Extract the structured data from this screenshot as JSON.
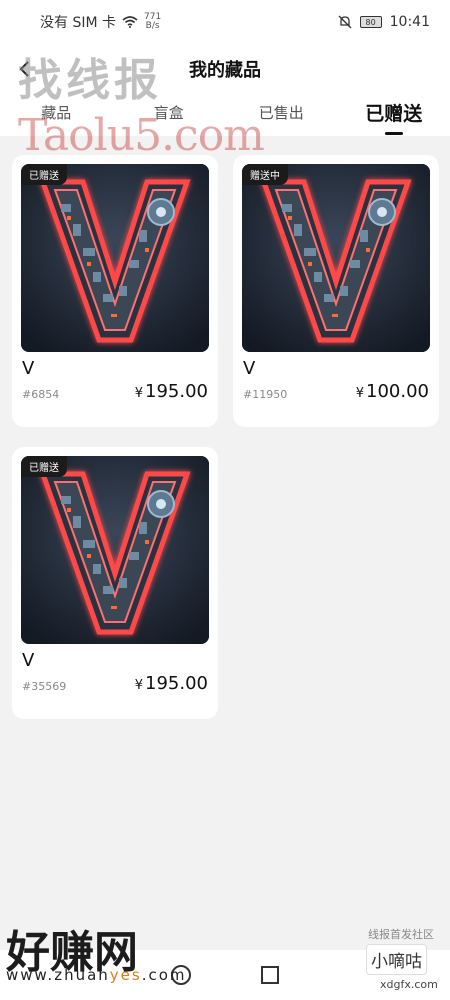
{
  "status_bar": {
    "carrier": "没有 SIM 卡",
    "speed_value": "771",
    "speed_unit": "B/s",
    "battery": "80",
    "time": "10:41"
  },
  "header": {
    "title": "我的藏品",
    "tabs": [
      {
        "label": "藏品",
        "active": false
      },
      {
        "label": "盲盒",
        "active": false
      },
      {
        "label": "已售出",
        "active": false
      },
      {
        "label": "已赠送",
        "active": true
      }
    ]
  },
  "items": [
    {
      "badge": "已赠送",
      "name": "V",
      "id": "#6854",
      "currency": "¥",
      "price": "195.00"
    },
    {
      "badge": "赠送中",
      "name": "V",
      "id": "#11950",
      "currency": "¥",
      "price": "100.00"
    },
    {
      "badge": "已赠送",
      "name": "V",
      "id": "#35569",
      "currency": "¥",
      "price": "195.00"
    }
  ],
  "watermarks": {
    "top": "找线报",
    "url": "Taolu5.com",
    "bottom": "好赚网",
    "bottom_url_a": "www.zhuan",
    "bottom_url_b": "yes",
    "bottom_url_c": ".com",
    "right_small": "线报首发社区",
    "right_btn": "小嘀咕",
    "right_url": "xdgfx.com"
  }
}
